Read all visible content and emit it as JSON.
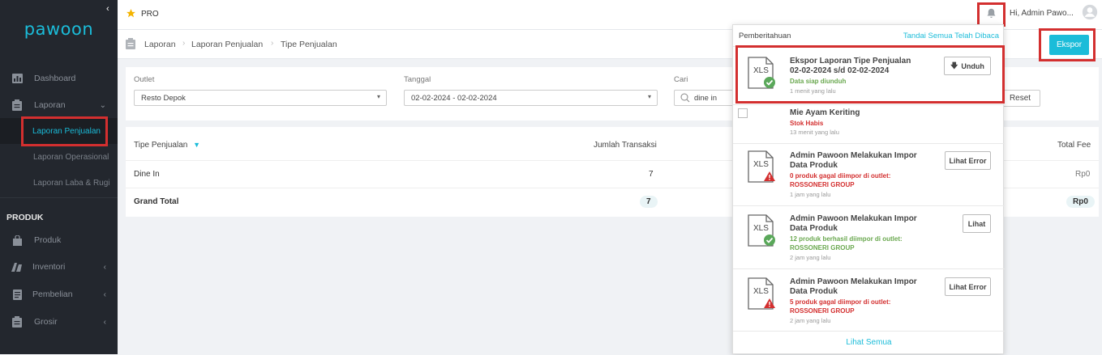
{
  "brand": {
    "logo": "pawoon",
    "accent": "#1bbcd9"
  },
  "topbar": {
    "plan": "PRO",
    "greeting": "Hi, Admin Pawo...",
    "bell_icon": "bell-icon",
    "user_icon": "user-circle-icon"
  },
  "sidebar": {
    "items": [
      {
        "label": "Dashboard",
        "icon": "dashboard-icon"
      },
      {
        "label": "Laporan",
        "icon": "clipboard-icon"
      },
      {
        "label": "Laporan Penjualan"
      },
      {
        "label": "Laporan Operasional"
      },
      {
        "label": "Laporan Laba & Rugi"
      }
    ],
    "section_produk": "PRODUK",
    "produk_items": [
      {
        "label": "Produk",
        "icon": "bag-icon"
      },
      {
        "label": "Inventori",
        "icon": "box-icon"
      },
      {
        "label": "Pembelian",
        "icon": "receipt-icon"
      },
      {
        "label": "Grosir",
        "icon": "clipboard-icon"
      }
    ]
  },
  "breadcrumb": {
    "items": [
      "Laporan",
      "Laporan Penjualan",
      "Tipe Penjualan"
    ]
  },
  "export_label": "Ekspor",
  "filters": {
    "outlet_label": "Outlet",
    "outlet_value": "Resto Depok",
    "date_label": "Tanggal",
    "date_value": "02-02-2024 - 02-02-2024",
    "search_label": "Cari",
    "search_value": "dine in",
    "reset_label": "Reset"
  },
  "table": {
    "headers": [
      "Tipe Penjualan",
      "Jumlah Transaksi",
      "Total Fee"
    ],
    "rows": [
      {
        "type": "Dine In",
        "count": "7",
        "fee": "Rp0"
      }
    ],
    "grand_total": {
      "label": "Grand Total",
      "count": "7",
      "fee": "Rp0"
    }
  },
  "notifications": {
    "title": "Pemberitahuan",
    "mark_all": "Tandai Semua Telah Dibaca",
    "see_all": "Lihat Semua",
    "items": [
      {
        "title": "Ekspor Laporan Tipe Penjualan 02-02-2024 s/d 02-02-2024",
        "status": "Data siap diunduh",
        "time": "1 menit yang lalu",
        "button": "Unduh"
      },
      {
        "title": "Mie Ayam Keriting",
        "status": "Stok Habis",
        "time": "13 menit yang lalu"
      },
      {
        "title": "Admin Pawoon Melakukan Impor Data Produk",
        "status": "0 produk gagal diimpor di outlet: ROSSONERI GROUP",
        "time": "1 jam yang lalu",
        "button": "Lihat Error"
      },
      {
        "title": "Admin Pawoon Melakukan Impor Data Produk",
        "status": "12 produk berhasil diimpor di outlet: ROSSONERI GROUP",
        "time": "2 jam yang lalu",
        "button": "Lihat"
      },
      {
        "title": "Admin Pawoon Melakukan Impor Data Produk",
        "status": "5 produk gagal diimpor di outlet: ROSSONERI GROUP",
        "time": "2 jam yang lalu",
        "button": "Lihat Error"
      }
    ],
    "file_label": "XLS"
  }
}
